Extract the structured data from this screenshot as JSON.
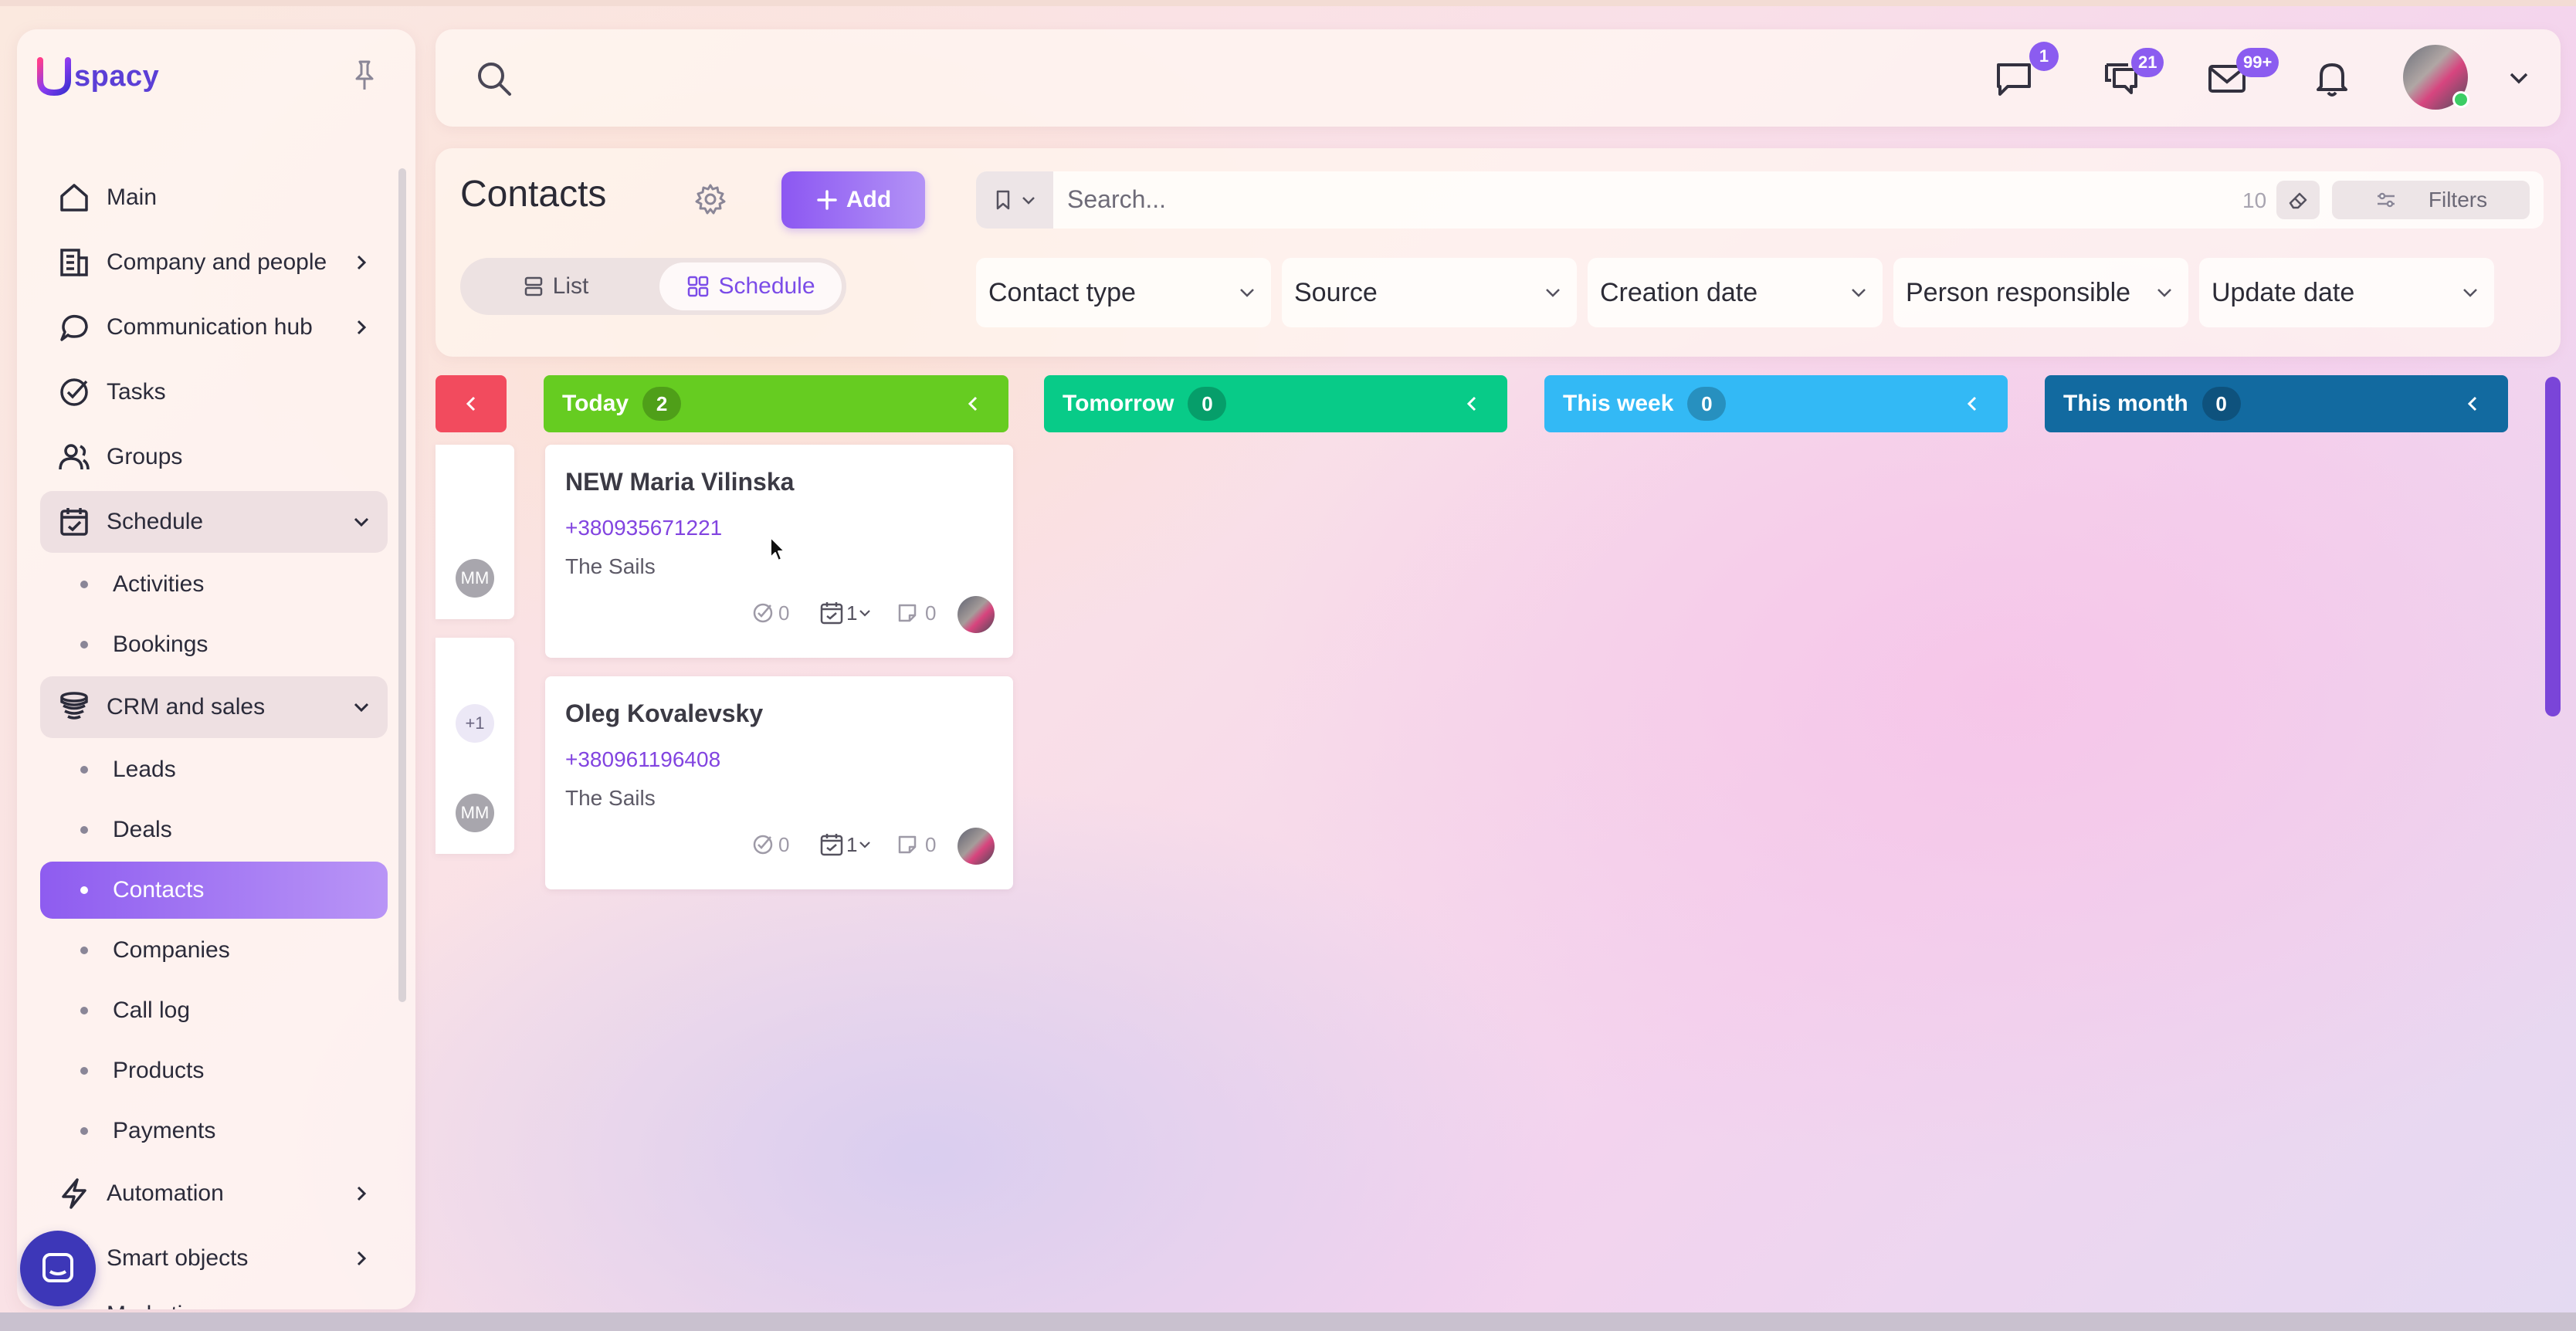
{
  "app": {
    "logo_text": "spacy"
  },
  "sidebar": {
    "items": [
      {
        "label": "Main",
        "icon": "home-icon"
      },
      {
        "label": "Company and people",
        "icon": "building-icon"
      },
      {
        "label": "Communication hub",
        "icon": "chat-icon"
      },
      {
        "label": "Tasks",
        "icon": "check-circle-icon"
      },
      {
        "label": "Groups",
        "icon": "users-icon"
      },
      {
        "label": "Schedule",
        "icon": "calendar-icon",
        "expanded": true,
        "children": [
          {
            "label": "Activities"
          },
          {
            "label": "Bookings"
          }
        ]
      },
      {
        "label": "CRM and sales",
        "icon": "database-icon",
        "expanded": true,
        "children": [
          {
            "label": "Leads"
          },
          {
            "label": "Deals"
          },
          {
            "label": "Contacts",
            "active": true
          },
          {
            "label": "Companies"
          },
          {
            "label": "Call log"
          },
          {
            "label": "Products"
          },
          {
            "label": "Payments"
          }
        ]
      },
      {
        "label": "Automation",
        "icon": "lightning-icon"
      },
      {
        "label": "Smart objects",
        "icon": "smart-object-icon"
      },
      {
        "label": "Marketing",
        "icon": "marketing-icon"
      }
    ]
  },
  "header": {
    "badges": {
      "chat": "1",
      "messages": "21",
      "mail": "99+"
    }
  },
  "page": {
    "title": "Contacts",
    "add_label": "Add",
    "view_list": "List",
    "view_schedule": "Schedule",
    "search_placeholder": "Search...",
    "result_count": "10",
    "filters_label": "Filters",
    "dropdowns": [
      "Contact type",
      "Source",
      "Creation date",
      "Person responsible",
      "Update date"
    ]
  },
  "columns": [
    {
      "label": "Today",
      "count": "2",
      "color": "#66cc21"
    },
    {
      "label": "Tomorrow",
      "count": "0",
      "color": "#08cb88"
    },
    {
      "label": "This week",
      "count": "0",
      "color": "#33b9f5"
    },
    {
      "label": "This month",
      "count": "0",
      "color": "#126aa0"
    }
  ],
  "cards": [
    {
      "name": "NEW Maria Vilinska",
      "phone": "+380935671221",
      "company": "The Sails",
      "tasks": "0",
      "activities": "1",
      "comments": "0"
    },
    {
      "name": "Oleg Kovalevsky",
      "phone": "+380961196408",
      "company": "The Sails",
      "tasks": "0",
      "activities": "1",
      "comments": "0"
    }
  ],
  "partial_column": {
    "avatar_initials": "MM",
    "extra": "+1",
    "color": "#f24b5e"
  }
}
